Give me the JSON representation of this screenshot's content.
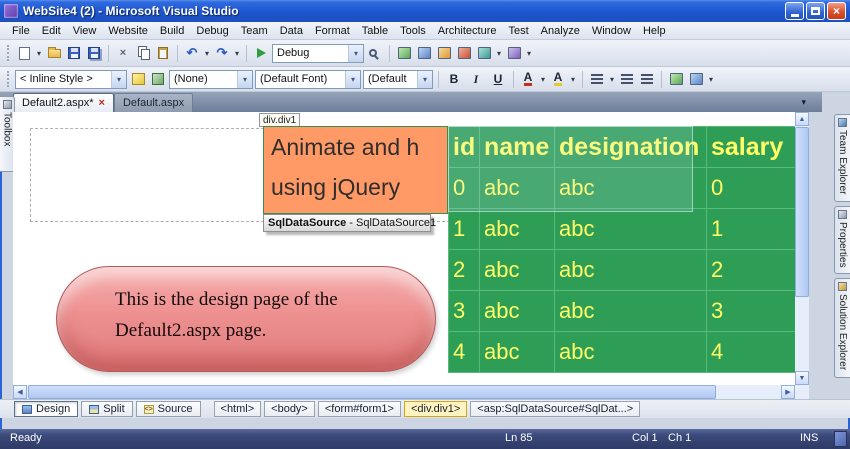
{
  "window": {
    "title": "WebSite4 (2) - Microsoft Visual Studio"
  },
  "menu": {
    "items": [
      "File",
      "Edit",
      "View",
      "Website",
      "Build",
      "Debug",
      "Team",
      "Data",
      "Format",
      "Table",
      "Tools",
      "Architecture",
      "Test",
      "Analyze",
      "Window",
      "Help"
    ]
  },
  "standard_toolbar": {
    "debug_label": "Debug"
  },
  "format_toolbar": {
    "style": "< Inline Style >",
    "target": "(None)",
    "font": "(Default Font)",
    "size": "(Default",
    "bold": "B",
    "italic": "I",
    "underline": "U"
  },
  "doc_tabs": [
    {
      "label": "Default2.aspx*"
    },
    {
      "label": "Default.aspx"
    }
  ],
  "left_dock": {
    "toolbox": "Toolbox"
  },
  "right_dock": {
    "tabs": [
      "Team Explorer",
      "Properties",
      "Solution Explorer"
    ]
  },
  "design": {
    "div_label": "div.div1",
    "banner": {
      "line1": "Animate and h",
      "line2": "using jQuery"
    },
    "datasource": {
      "name": "SqlDataSource",
      "suffix": " - SqlDataSource1"
    },
    "note": {
      "line1": "This is the design page of the",
      "line2": "Default2.aspx page."
    }
  },
  "grid": {
    "headers": [
      "id",
      "name",
      "designation",
      "salary"
    ],
    "rows": [
      [
        "0",
        "abc",
        "abc",
        "0"
      ],
      [
        "1",
        "abc",
        "abc",
        "1"
      ],
      [
        "2",
        "abc",
        "abc",
        "2"
      ],
      [
        "3",
        "abc",
        "abc",
        "3"
      ],
      [
        "4",
        "abc",
        "abc",
        "4"
      ]
    ]
  },
  "view_bar": {
    "views": [
      "Design",
      "Split",
      "Source"
    ],
    "breadcrumbs": [
      "<html>",
      "<body>",
      "<form#form1>",
      "<div.div1>",
      "<asp:SqlDataSource#SqlDat...>"
    ]
  },
  "status_bar": {
    "state": "Ready",
    "line": "Ln 85",
    "column": "Col 1",
    "character": "Ch 1",
    "mode": "INS"
  },
  "icons": {
    "close": "×",
    "chevron_down": "▾",
    "undo": "↶",
    "redo": "↷",
    "up": "▲",
    "down": "▼",
    "left": "◀",
    "right": "▶",
    "code": "<>",
    "font_color": "A",
    "highlight": "A"
  },
  "colors": {
    "table_green": "#2E9E57",
    "cell_yellow": "#FFFF66",
    "banner_orange": "#FF9966",
    "note_pink": "#EE8E8E",
    "title_blue": "#1C55CE",
    "status_navy": "#2E3A66"
  }
}
